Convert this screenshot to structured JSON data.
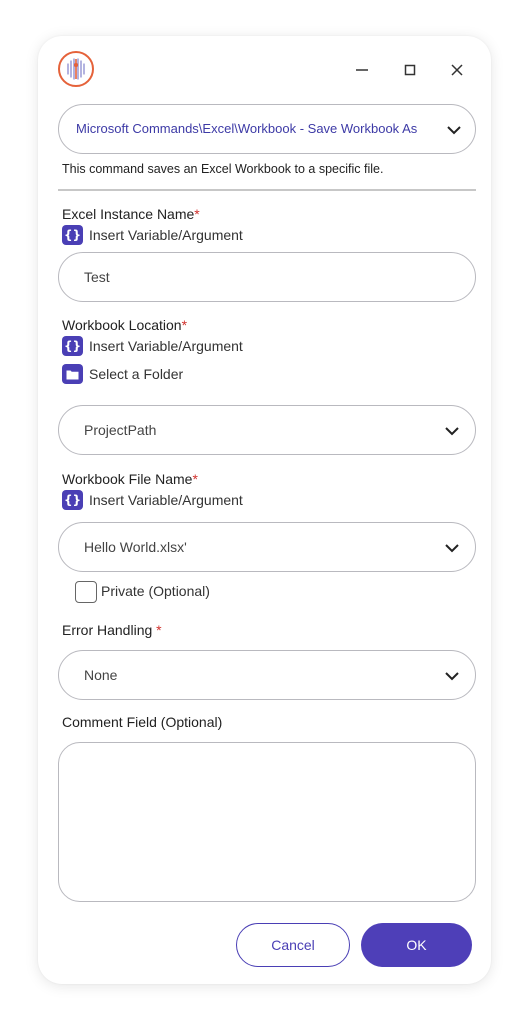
{
  "window": {
    "app_icon": "waveform-logo-icon",
    "minimize_icon": "minimize-icon",
    "maximize_icon": "maximize-icon",
    "close_icon": "close-icon"
  },
  "command": {
    "selected": "Microsoft Commands\\Excel\\Workbook - Save Workbook As",
    "description": "This command saves an Excel Workbook to a specific file."
  },
  "excel_instance": {
    "label": "Excel Instance Name",
    "required_mark": "*",
    "insert_variable": "Insert Variable/Argument",
    "value": "Test"
  },
  "workbook_location": {
    "label": "Workbook Location",
    "required_mark": "*",
    "insert_variable": "Insert Variable/Argument",
    "select_folder": "Select a Folder",
    "value": "ProjectPath"
  },
  "workbook_file_name": {
    "label": "Workbook File Name",
    "required_mark": "*",
    "insert_variable": "Insert Variable/Argument",
    "value": "Hello World.xlsx'"
  },
  "private": {
    "label": "Private (Optional)",
    "checked": false
  },
  "error_handling": {
    "label": "Error Handling ",
    "required_mark": "*",
    "value": "None"
  },
  "comment": {
    "label": "Comment Field (Optional)",
    "value": ""
  },
  "buttons": {
    "cancel": "Cancel",
    "ok": "OK"
  },
  "colors": {
    "accent": "#4a3fb5",
    "required": "#d0312d",
    "logo": "#e5623a"
  }
}
